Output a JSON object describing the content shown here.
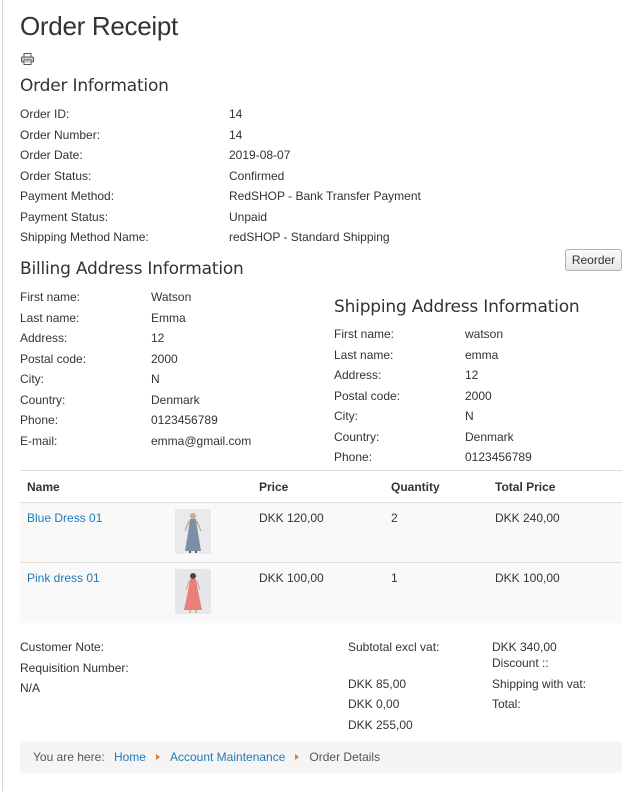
{
  "page": {
    "title": "Order Receipt"
  },
  "order_info": {
    "heading": "Order Information",
    "rows": [
      {
        "label": "Order ID:",
        "value": "14"
      },
      {
        "label": "Order Number:",
        "value": "14"
      },
      {
        "label": "Order Date:",
        "value": "2019-08-07"
      },
      {
        "label": "Order Status:",
        "value": "Confirmed"
      },
      {
        "label": "Payment Method:",
        "value": "RedSHOP - Bank Transfer Payment"
      },
      {
        "label": "Payment Status:",
        "value": "Unpaid"
      },
      {
        "label": "Shipping Method Name:",
        "value": "redSHOP - Standard Shipping"
      }
    ]
  },
  "reorder_label": "Reorder",
  "billing": {
    "heading": "Billing Address Information",
    "rows": [
      {
        "label": "First name:",
        "value": "Watson"
      },
      {
        "label": "Last name:",
        "value": "Emma"
      },
      {
        "label": "Address:",
        "value": "12"
      },
      {
        "label": "Postal code:",
        "value": "2000"
      },
      {
        "label": "City:",
        "value": "N"
      },
      {
        "label": "Country:",
        "value": "Denmark"
      },
      {
        "label": "Phone:",
        "value": "0123456789"
      },
      {
        "label": "E-mail:",
        "value": "emma@gmail.com"
      }
    ]
  },
  "shipping": {
    "heading": "Shipping Address Information",
    "rows": [
      {
        "label": "First name:",
        "value": "watson"
      },
      {
        "label": "Last name:",
        "value": "emma"
      },
      {
        "label": "Address:",
        "value": "12"
      },
      {
        "label": "Postal code:",
        "value": "2000"
      },
      {
        "label": "City:",
        "value": "N"
      },
      {
        "label": "Country:",
        "value": "Denmark"
      },
      {
        "label": "Phone:",
        "value": "0123456789"
      }
    ]
  },
  "items": {
    "columns": [
      "Name",
      "Price",
      "Quantity",
      "Total Price"
    ],
    "rows": [
      {
        "name": "Blue Dress 01",
        "price": "DKK 120,00",
        "quantity": "2",
        "total": "DKK 240,00",
        "image_color": "#7d8ea6"
      },
      {
        "name": "Pink dress 01",
        "price": "DKK 100,00",
        "quantity": "1",
        "total": "DKK 100,00",
        "image_color": "#e7807a"
      }
    ]
  },
  "notes": {
    "customer_note": "Customer Note:",
    "requisition_number": "Requisition Number:",
    "requisition_value": "N/A"
  },
  "totals": {
    "subtotal_label": "Subtotal excl vat:",
    "subtotal_value": "DKK 340,00",
    "discount_label": "Discount ::",
    "discount_value": "DKK 85,00",
    "shipping_label": "Shipping with vat:",
    "shipping_value": "DKK 0,00",
    "total_label": "Total:",
    "total_value": "DKK 255,00"
  },
  "breadcrumb": {
    "prefix": "You are here:",
    "items": [
      "Home",
      "Account Maintenance",
      "Order Details"
    ]
  },
  "colors": {
    "link": "#1e7bb8",
    "separator": "#e57a28"
  },
  "icons": {
    "print": "printer-icon",
    "separator": "triangle-right-icon"
  }
}
